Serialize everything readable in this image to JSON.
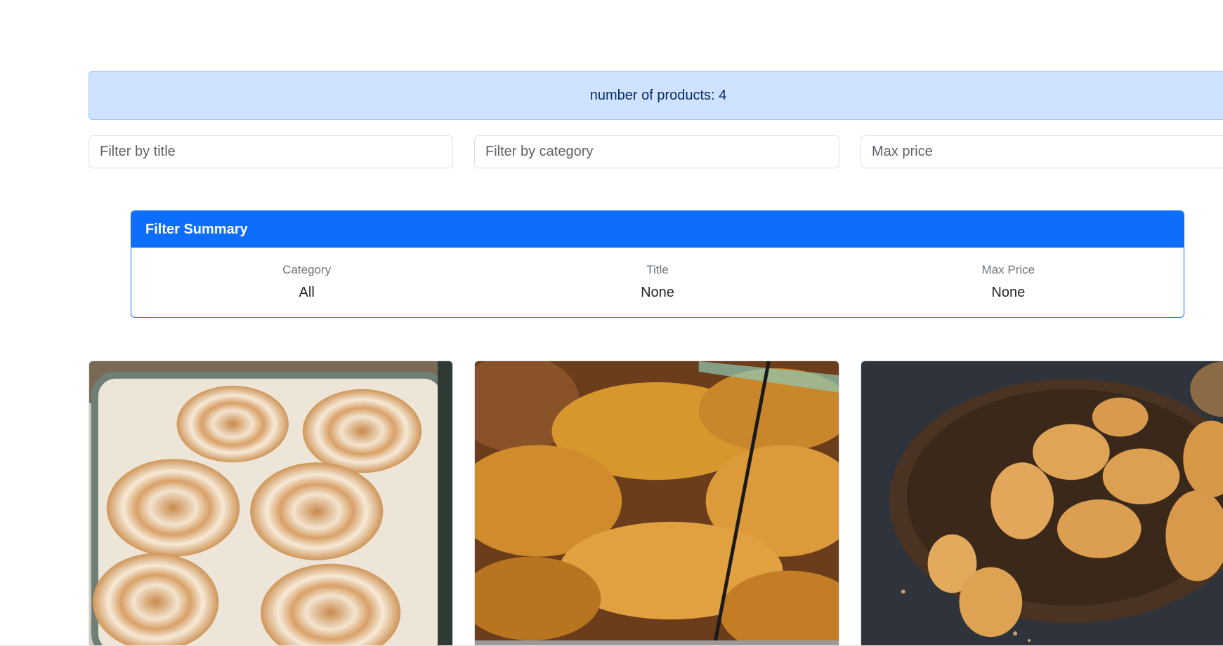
{
  "alert": {
    "text": "number of products: 4"
  },
  "filters": {
    "title_placeholder": "Filter by title",
    "title_value": "",
    "category_placeholder": "Filter by category",
    "category_value": "",
    "price_placeholder": "Max price",
    "price_value": ""
  },
  "summary": {
    "header": "Filter Summary",
    "columns": [
      {
        "label": "Category",
        "value": "All"
      },
      {
        "label": "Title",
        "value": "None"
      },
      {
        "label": "Max Price",
        "value": "None"
      }
    ]
  },
  "products": [
    {
      "image": "cinnamon-rolls-photo"
    },
    {
      "image": "croissants-photo"
    },
    {
      "image": "madeleines-photo"
    }
  ],
  "colors": {
    "primary": "#0d6efd",
    "alert_bg": "#cfe2ff",
    "alert_text": "#052c65"
  }
}
